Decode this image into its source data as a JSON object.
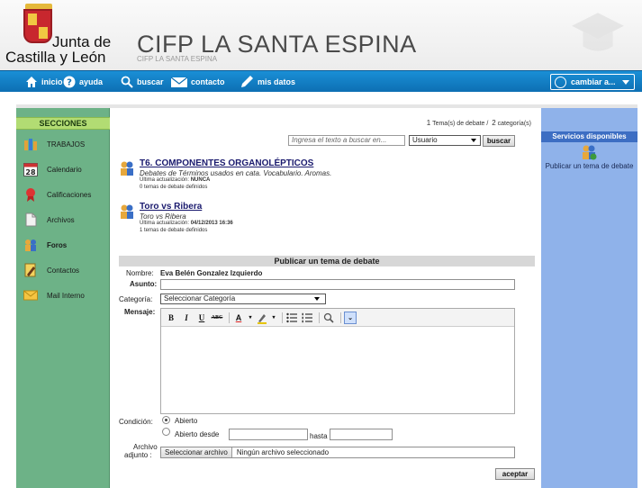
{
  "header": {
    "logo_line1": "Junta de",
    "logo_line2": "Castilla y León",
    "title": "CIFP LA SANTA ESPINA",
    "subtitle": "CIFP LA SANTA ESPINA"
  },
  "nav": {
    "items": [
      {
        "label": "inicio",
        "icon": "home-icon"
      },
      {
        "label": "ayuda",
        "icon": "help-icon"
      },
      {
        "label": "buscar",
        "icon": "search-icon"
      },
      {
        "label": "contacto",
        "icon": "mail-icon"
      },
      {
        "label": "mis datos",
        "icon": "pencil-icon"
      }
    ],
    "switch_label": "cambiar a..."
  },
  "sidebar": {
    "heading": "SECCIONES",
    "items": [
      {
        "label": "TRABAJOS",
        "icon": "works-icon"
      },
      {
        "label": "Calendario",
        "icon": "calendar-icon",
        "day": "28"
      },
      {
        "label": "Calificaciones",
        "icon": "grades-icon"
      },
      {
        "label": "Archivos",
        "icon": "files-icon"
      },
      {
        "label": "Foros",
        "icon": "forums-icon"
      },
      {
        "label": "Contactos",
        "icon": "contacts-icon"
      },
      {
        "label": "Mail Interno",
        "icon": "mail-icon"
      }
    ]
  },
  "summary": {
    "topics_count": "1",
    "topics_label": "Tema(s) de debate /",
    "categories_count": "2",
    "categories_label": "categoría(s)"
  },
  "search": {
    "placeholder": "Ingresa el texto a buscar en...",
    "field": "Usuario",
    "button": "buscar"
  },
  "categories": [
    {
      "title": "T6. COMPONENTES ORGANOLÉPTICOS",
      "description": "Debates de Términos usados en cata. Vocabulario. Aromas.",
      "last_update_label": "Última actualización:",
      "last_update": "NUNCA",
      "count_text": "0 temas de debate definidos"
    },
    {
      "title": "Toro vs Ribera",
      "description": "Toro vs Ribera",
      "last_update_label": "Última actualización:",
      "last_update": "04/12/2013 16:36",
      "count_text": "1 temas de debate definidos"
    }
  ],
  "form": {
    "heading": "Publicar un tema de debate",
    "name_label": "Nombre:",
    "name_value": "Eva Belén Gonzalez Izquierdo",
    "subject_label": "Asunto:",
    "subject_value": "",
    "category_label": "Categoría:",
    "category_value": "Seleccionar Categoría",
    "message_label": "Mensaje:",
    "condition_label": "Condición:",
    "radio_open": "Abierto",
    "radio_open_from": "Abierto desde",
    "until_label": "hasta",
    "attachment_label_1": "Archivo",
    "attachment_label_2": "adjunto :",
    "file_button": "Seleccionar archivo",
    "file_status": "Ningún archivo seleccionado",
    "submit": "aceptar"
  },
  "toolbar": {
    "bold": "B",
    "italic": "I",
    "underline": "U",
    "strike": "ABC",
    "font_color": "A"
  },
  "right_panel": {
    "heading": "Servicios disponibles",
    "link": "Publicar un tema de debate"
  }
}
